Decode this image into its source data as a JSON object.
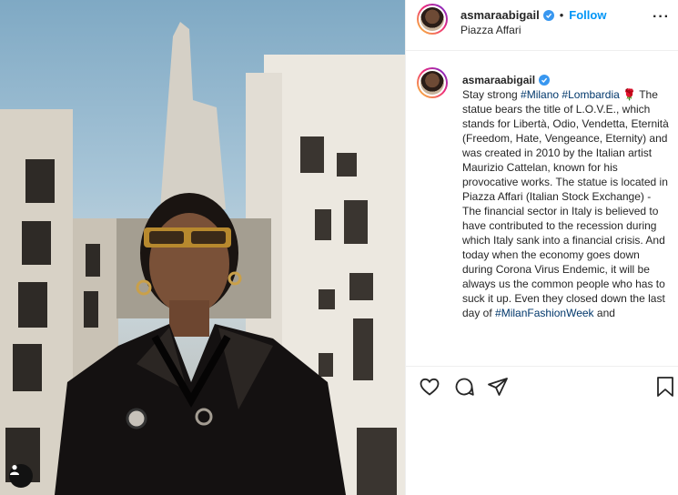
{
  "post": {
    "username": "asmaraabigail",
    "follow_label": "Follow",
    "location": "Piazza Affari",
    "more_label": "···"
  },
  "caption": {
    "username": "asmaraabigail",
    "lead": "Stay strong",
    "hashtag_1": "#Milano",
    "hashtag_2": "#Lombardia",
    "emoji": "🌹",
    "body": "The statue bears the title of L.O.V.E., which stands for Libertà, Odio, Vendetta, Eternità (Freedom, Hate, Vengeance, Eternity) and was created in 2010 by the Italian artist Maurizio Cattelan, known for his provocative works. The statue is located in Piazza Affari (Italian Stock Exchange) - The financial sector in Italy is believed to have contributed to the recession during which Italy sank into a financial crisis. And today when the economy goes down during Corona Virus Endemic, it will be always us the common people who has to suck it up. Even they closed down the last day of",
    "hashtag_3": "#MilanFashionWeek",
    "tail": "and"
  },
  "icons": {
    "like": "heart-icon",
    "comment": "comment-icon",
    "share": "paper-plane-icon",
    "save": "bookmark-icon",
    "tagged_users": "user-icon",
    "verified": "verified-badge-icon"
  },
  "colors": {
    "link_blue": "#0095f6",
    "hashtag": "#00376b",
    "verified": "#3897f0"
  }
}
